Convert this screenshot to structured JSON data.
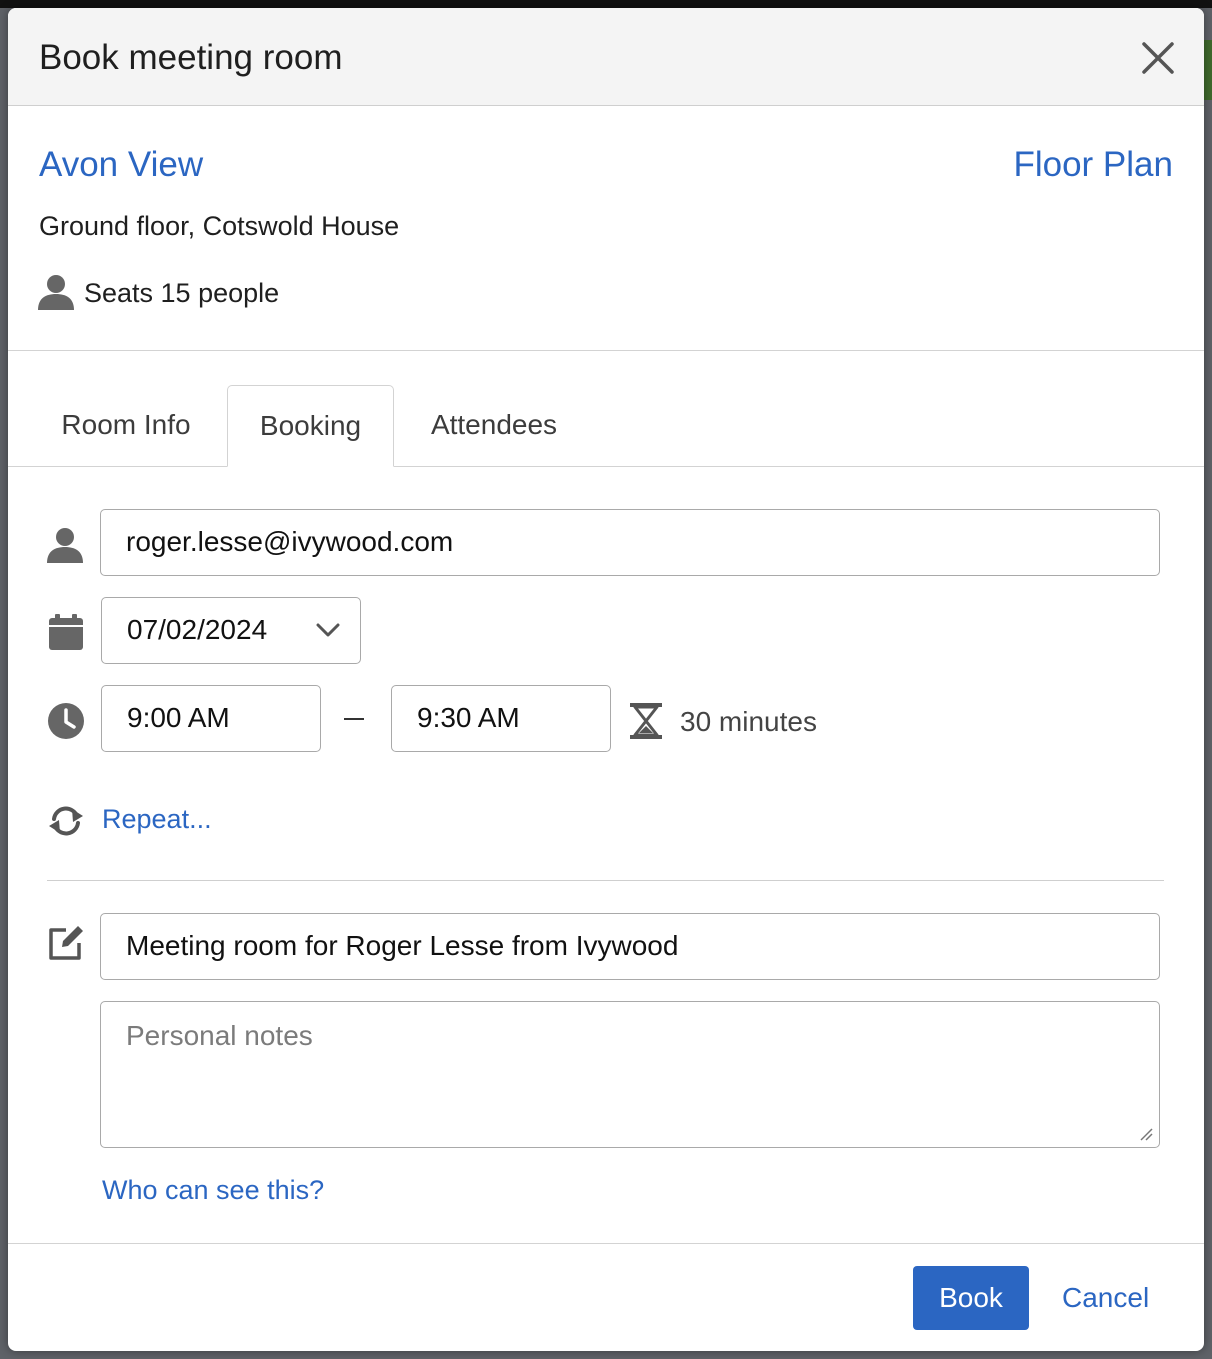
{
  "dialog": {
    "title": "Book meeting room",
    "close_icon": "close-icon"
  },
  "room": {
    "name": "Avon View",
    "floor_plan_link": "Floor Plan",
    "location": "Ground floor, Cotswold House",
    "seats": "Seats 15 people",
    "seats_icon": "person-icon"
  },
  "tabs": [
    {
      "label": "Room Info",
      "active": false
    },
    {
      "label": "Booking",
      "active": true
    },
    {
      "label": "Attendees",
      "active": false
    }
  ],
  "booking": {
    "email": {
      "icon": "person-icon",
      "value": "roger.lesse@ivywood.com"
    },
    "date": {
      "icon": "calendar-icon",
      "value": "07/02/2024",
      "dropdown_icon": "chevron-down-icon"
    },
    "time": {
      "icon": "clock-icon",
      "start": "9:00 AM",
      "end": "9:30 AM",
      "duration_icon": "hourglass-icon",
      "duration": "30 minutes"
    },
    "repeat": {
      "icon": "repeat-icon",
      "label": "Repeat..."
    },
    "subject": {
      "icon": "edit-icon",
      "value": "Meeting room for Roger Lesse from Ivywood"
    },
    "notes": {
      "value": "",
      "placeholder": "Personal notes"
    },
    "visibility_link": "Who can see this?"
  },
  "actions": {
    "book_label": "Book",
    "cancel_label": "Cancel"
  },
  "colors": {
    "accent": "#2b66c2",
    "header_bg": "#f4f4f4",
    "icon_gray": "#666666"
  }
}
